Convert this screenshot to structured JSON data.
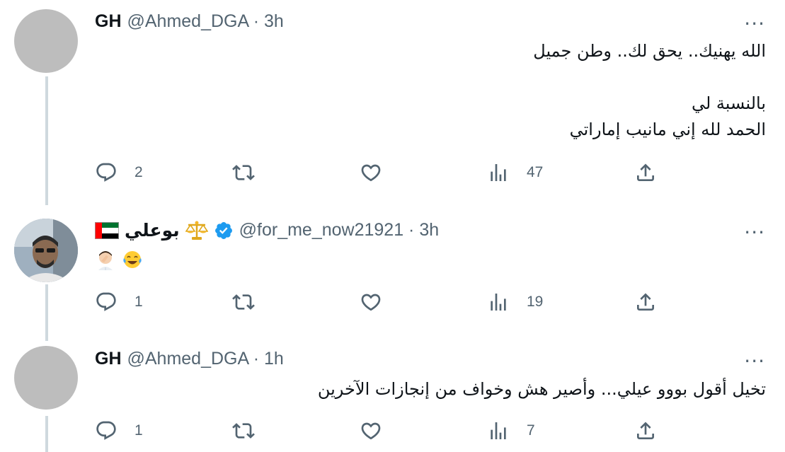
{
  "tweets": [
    {
      "name": "GH",
      "handle": "@Ahmed_DGA · 3h",
      "text": [
        "الله يهنيك.. يحق لك.. وطن جميل",
        "",
        "بالنسبة لي",
        "الحمد لله إني مانيب إماراتي"
      ],
      "replies": "2",
      "retweets": "",
      "likes": "",
      "views": "47"
    },
    {
      "name": "بوعلي",
      "handle": "@for_me_now21921 · 3h",
      "text": [
        "🤦🏻‍♂️😂"
      ],
      "replies": "1",
      "retweets": "",
      "likes": "",
      "views": "19"
    },
    {
      "name": "GH",
      "handle": "@Ahmed_DGA · 1h",
      "text": [
        "تخيل أقول  بووو عيلي... وأصير هش وخواف من إنجازات الآخرين"
      ],
      "replies": "1",
      "retweets": "",
      "likes": "",
      "views": "7"
    }
  ],
  "icons": {
    "reply": "reply-icon",
    "retweet": "retweet-icon",
    "like": "like-icon",
    "views": "views-icon",
    "share": "share-icon",
    "more": "more-icon",
    "verified": "verified-badge-icon",
    "flag": "uae-flag-icon",
    "scales": "scales-icon"
  },
  "colors": {
    "text": "#0f1419",
    "secondary": "#536471",
    "verified": "#1d9bf0",
    "thread_line": "#cfd9de"
  }
}
